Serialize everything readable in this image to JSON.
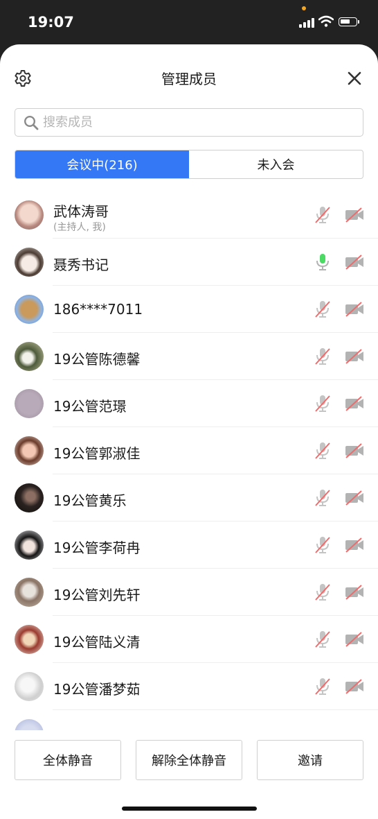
{
  "status_bar": {
    "time": "19:07"
  },
  "header": {
    "title": "管理成员"
  },
  "search": {
    "placeholder": "搜索成员"
  },
  "tabs": [
    {
      "label": "会议中(216)",
      "active": true
    },
    {
      "label": "未入会",
      "active": false
    }
  ],
  "members": [
    {
      "name": "武体涛哥",
      "subtitle": "(主持人, 我)",
      "mic": "muted",
      "camera": "off",
      "avatar": "baby-photo"
    },
    {
      "name": "聂秀书记",
      "mic": "on",
      "camera": "off",
      "avatar": "anime-girl"
    },
    {
      "name": "186****7011",
      "mic": "muted",
      "camera": "off",
      "avatar": "dog-photo"
    },
    {
      "name": "19公管陈德馨",
      "mic": "muted",
      "camera": "off",
      "avatar": "flower-photo"
    },
    {
      "name": "19公管范璟",
      "mic": "muted",
      "camera": "off",
      "avatar": "plain-gray"
    },
    {
      "name": "19公管郭淑佳",
      "mic": "muted",
      "camera": "off",
      "avatar": "sunglasses-girl"
    },
    {
      "name": "19公管黄乐",
      "mic": "muted",
      "camera": "off",
      "avatar": "dark-photo"
    },
    {
      "name": "19公管李荷冉",
      "mic": "muted",
      "camera": "off",
      "avatar": "black-hair-girl"
    },
    {
      "name": "19公管刘先轩",
      "mic": "muted",
      "camera": "off",
      "avatar": "cat-photo"
    },
    {
      "name": "19公管陆义清",
      "mic": "muted",
      "camera": "off",
      "avatar": "illustration"
    },
    {
      "name": "19公管潘梦茹",
      "mic": "muted",
      "camera": "off",
      "avatar": "light-photo"
    }
  ],
  "footer": {
    "mute_all": "全体静音",
    "unmute_all": "解除全体静音",
    "invite": "邀请"
  },
  "colors": {
    "accent": "#3478f6",
    "mic_on": "#4cd964",
    "muted_slash": "#f06b6b",
    "icon_gray": "#b3b3b3"
  }
}
